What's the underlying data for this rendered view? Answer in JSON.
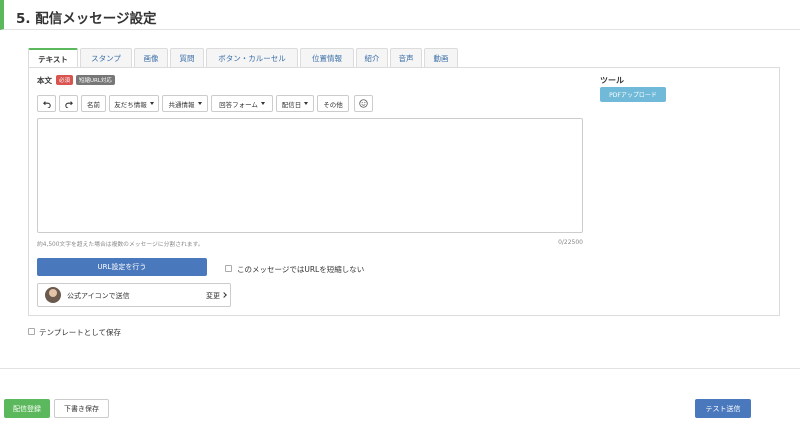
{
  "section": {
    "title": "5. 配信メッセージ設定"
  },
  "tabs": [
    {
      "label": "テキスト",
      "active": true
    },
    {
      "label": "スタンプ"
    },
    {
      "label": "画像"
    },
    {
      "label": "質問"
    },
    {
      "label": "ボタン・カルーセル"
    },
    {
      "label": "位置情報"
    },
    {
      "label": "紹介"
    },
    {
      "label": "音声"
    },
    {
      "label": "動画"
    }
  ],
  "editor": {
    "body_label": "本文",
    "required_badge": "必須",
    "short_url_badge": "短縮URL対応",
    "toolbar": {
      "name": "名前",
      "friend_info": "友だち情報",
      "common_info": "共通情報",
      "answer_form": "回答フォーム",
      "delivery_date": "配信日",
      "other": "その他"
    },
    "textarea_value": "",
    "note": "約4,500文字を超えた場合は複数のメッセージに分割されます。",
    "char_count": "0/22500",
    "url_button": "URL設定を行う",
    "no_shorten_label": "このメッセージではURLを短縮しない",
    "sender_label": "公式アイコンで送信",
    "change_label": "変更"
  },
  "tools": {
    "heading": "ツール",
    "pdf_upload": "PDFアップロード"
  },
  "template_save_label": "テンプレートとして保存",
  "footer": {
    "register": "配信登録",
    "draft": "下書き保存",
    "test_send": "テスト送信"
  },
  "colors": {
    "accent_green": "#5cb85c",
    "primary_blue": "#4a78bd",
    "info_blue": "#70b9d8",
    "required_red": "#d9534f"
  }
}
